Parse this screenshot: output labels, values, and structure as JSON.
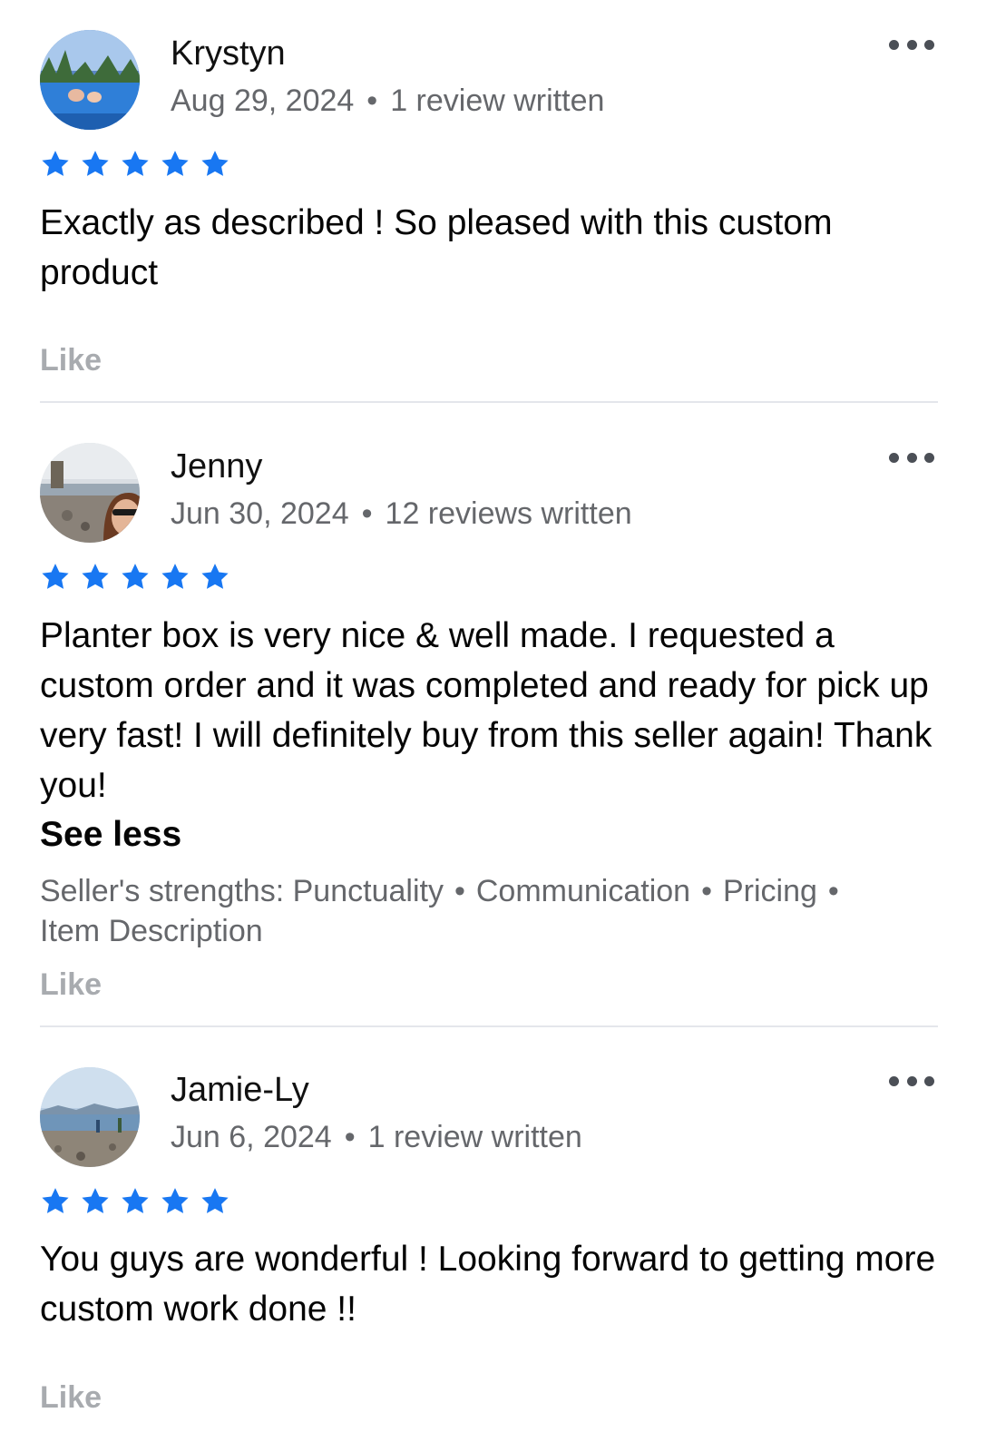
{
  "colors": {
    "star": "#1877f2",
    "meta": "#65676b",
    "like": "#a8abaf"
  },
  "reviews": [
    {
      "avatar_icon": "avatar-pool-photo",
      "name": "Krystyn",
      "date": "Aug 29, 2024",
      "separator": "•",
      "count": "1 review written",
      "rating": 5,
      "text": "Exactly as described ! So pleased with this custom product",
      "like": "Like",
      "more_icon": "more-options-icon"
    },
    {
      "avatar_icon": "avatar-beach-selfie",
      "name": "Jenny",
      "date": "Jun 30, 2024",
      "separator": "•",
      "count": "12 reviews written",
      "rating": 5,
      "text": "Planter box is very nice & well made. I requested a custom order and it was completed and ready for pick up very fast! I will definitely buy from this seller again! Thank you!",
      "see_less": "See less",
      "strengths_label": "Seller's strengths:",
      "strengths": [
        "Punctuality",
        "Communication",
        "Pricing",
        "Item Description"
      ],
      "like": "Like",
      "more_icon": "more-options-icon"
    },
    {
      "avatar_icon": "avatar-shoreline-photo",
      "name": "Jamie-Ly",
      "date": "Jun 6, 2024",
      "separator": "•",
      "count": "1 review written",
      "rating": 5,
      "text": "You guys are wonderful ! Looking forward to getting more custom work done !!",
      "like": "Like",
      "more_icon": "more-options-icon"
    }
  ]
}
